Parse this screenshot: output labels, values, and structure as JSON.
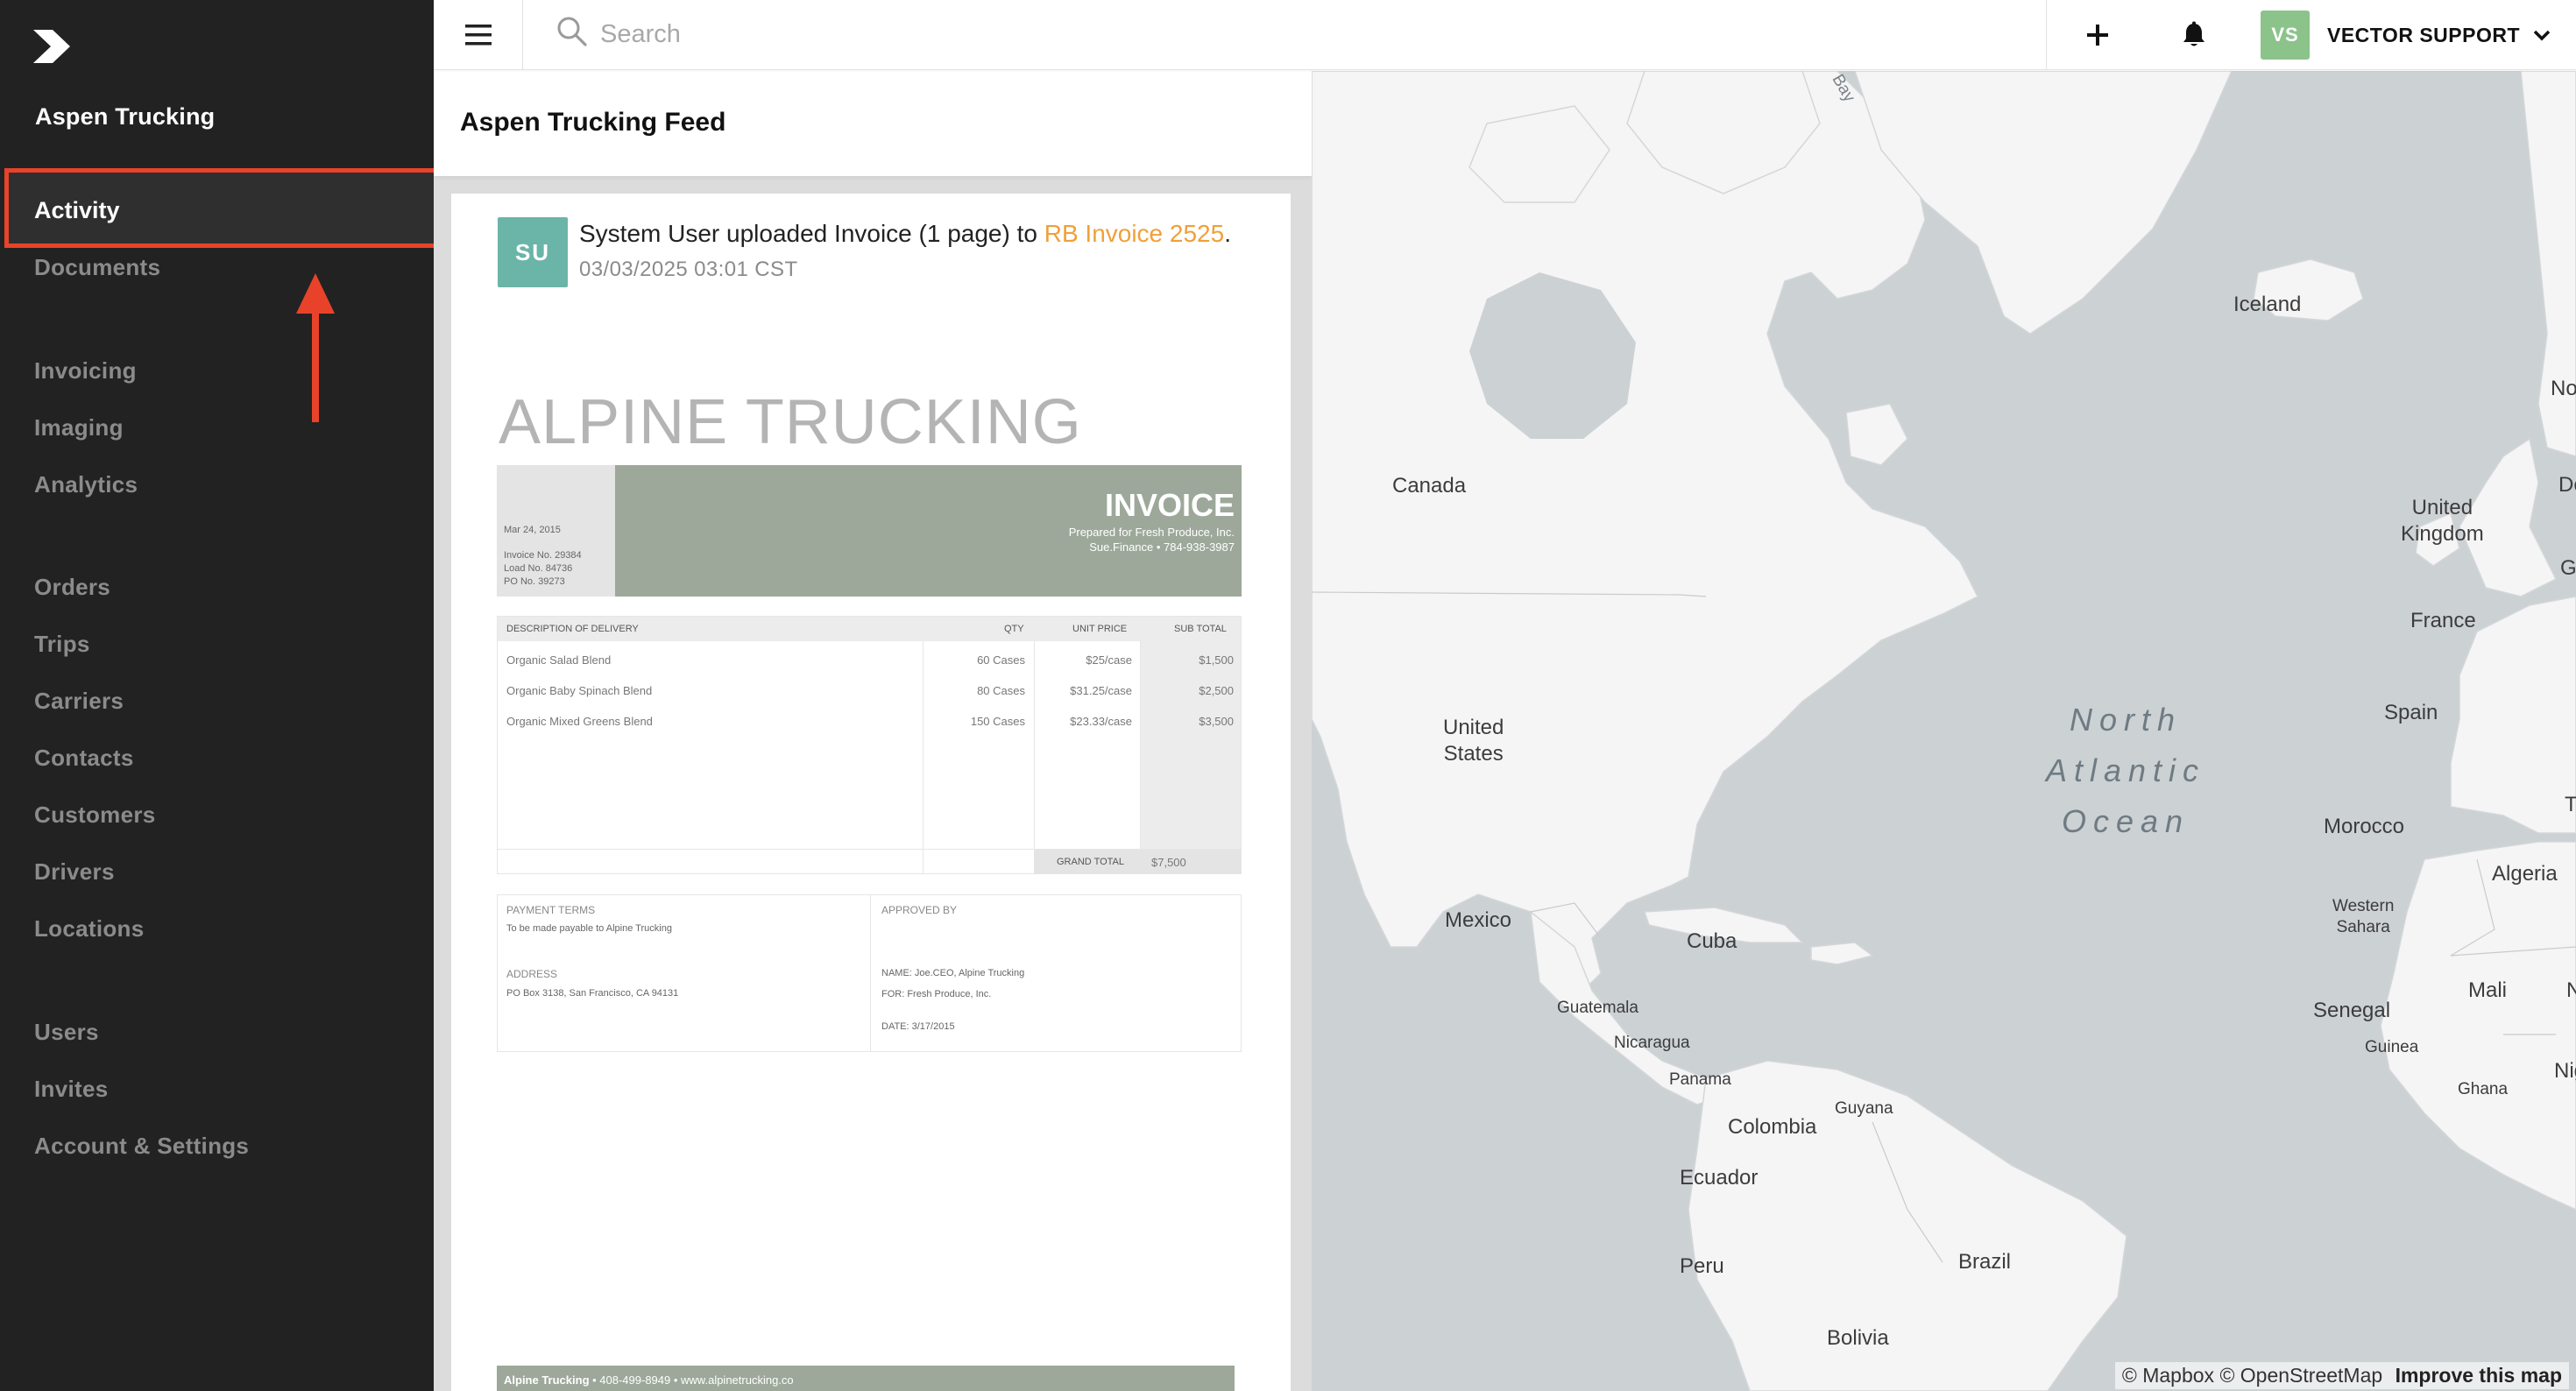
{
  "sidebar": {
    "company": "Aspen Trucking",
    "active_item": "Activity",
    "items": [
      "Documents",
      "Invoicing",
      "Imaging",
      "Analytics",
      "Orders",
      "Trips",
      "Carriers",
      "Contacts",
      "Customers",
      "Drivers",
      "Locations",
      "Users",
      "Invites",
      "Account & Settings"
    ]
  },
  "topbar": {
    "search_placeholder": "Search",
    "user_initials": "VS",
    "user_name": "VECTOR SUPPORT",
    "avatar_color": "#8cc38b"
  },
  "feed": {
    "title": "Aspen Trucking Feed",
    "entry": {
      "avatar_initials": "SU",
      "avatar_color": "#6ab5a8",
      "actor": "System User",
      "action": " uploaded Invoice (1 page) to ",
      "link_text": "RB Invoice 2525",
      "period": ".",
      "timestamp": "03/03/2025 03:01 CST"
    }
  },
  "invoice_doc": {
    "company": "ALPINE TRUCKING",
    "heading": "INVOICE",
    "prepared_for": "Prepared for Fresh Produce, Inc.",
    "contact": "Sue.Finance • 784-938-3987",
    "date": "Mar 24, 2015",
    "invoice_no": "Invoice No. 29384",
    "load_no": "Load No. 84736",
    "po_no": "PO No. 39273",
    "columns": [
      "DESCRIPTION OF DELIVERY",
      "QTY",
      "UNIT PRICE",
      "SUB TOTAL"
    ],
    "rows": [
      {
        "desc": "Organic Salad Blend",
        "qty": "60 Cases",
        "price": "$25/case",
        "subtotal": "$1,500"
      },
      {
        "desc": "Organic Baby Spinach Blend",
        "qty": "80 Cases",
        "price": "$31.25/case",
        "subtotal": "$2,500"
      },
      {
        "desc": "Organic Mixed Greens Blend",
        "qty": "150 Cases",
        "price": "$23.33/case",
        "subtotal": "$3,500"
      }
    ],
    "grand_total_label": "GRAND TOTAL",
    "grand_total": "$7,500",
    "payment_terms_label": "PAYMENT TERMS",
    "payment_terms": "To be made payable to Alpine Trucking",
    "address_label": "ADDRESS",
    "address": "PO Box 3138, San Francisco, CA 94131",
    "approved_by_label": "APPROVED BY",
    "approved_name": "NAME: Joe.CEO, Alpine Trucking",
    "approved_for": "FOR:  Fresh Produce, Inc.",
    "approved_date": "DATE:  3/17/2015",
    "footer_name": "Alpine Trucking",
    "footer_rest": " • 408-499-8949 • www.alpinetrucking.co"
  },
  "map": {
    "labels": {
      "canada": "Canada",
      "iceland": "Iceland",
      "united_states": "United\nStates",
      "united_kingdom": "United\nKingdom",
      "france": "France",
      "spain": "Spain",
      "morocco": "Morocco",
      "algeria": "Algeria",
      "western_sahara": "Western\nSahara",
      "mali": "Mali",
      "senegal": "Senegal",
      "guinea": "Guinea",
      "ghana": "Ghana",
      "mexico": "Mexico",
      "cuba": "Cuba",
      "guatemala": "Guatemala",
      "nicaragua": "Nicaragua",
      "panama": "Panama",
      "colombia": "Colombia",
      "guyana": "Guyana",
      "ecuador": "Ecuador",
      "peru": "Peru",
      "brazil": "Brazil",
      "bolivia": "Bolivia",
      "bay": "Bay",
      "no": "No",
      "de": "De",
      "ge": "Ge",
      "t": "T",
      "n": "N",
      "nig": "Nig"
    },
    "ocean": "North\nAtlantic\nOcean",
    "attribution_mapbox": "© Mapbox",
    "attribution_osm": "© OpenStreetMap",
    "improve_link": "Improve this map",
    "land_color": "#f5f5f5",
    "water_color": "#ccd1d4"
  },
  "annotation_color": "#e8432a"
}
